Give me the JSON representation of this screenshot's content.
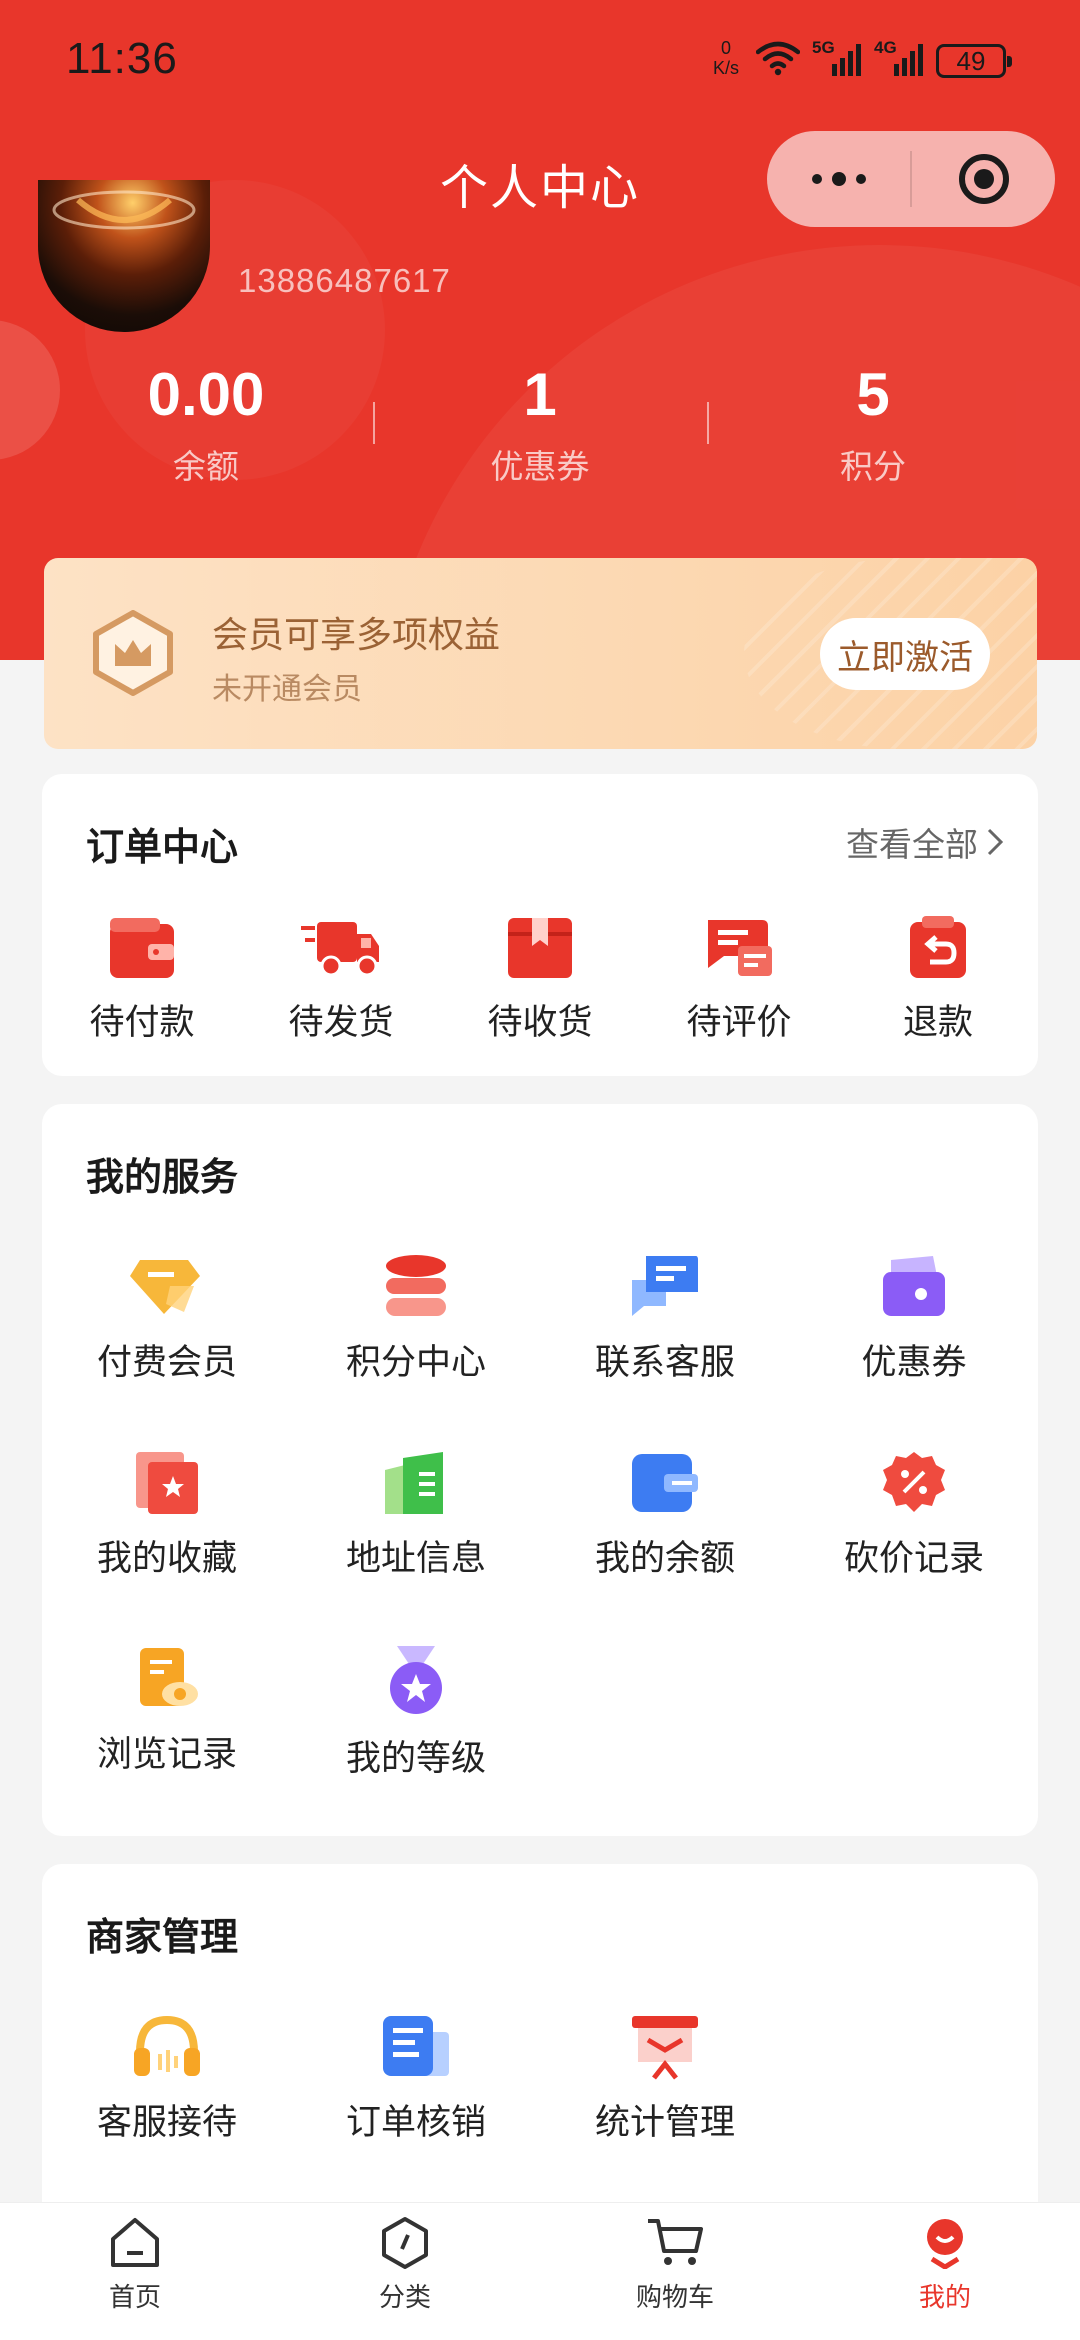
{
  "status_bar": {
    "time": "11:36",
    "net_speed_value": "0",
    "net_speed_unit": "K/s",
    "battery": "49",
    "net1": "5G",
    "net2": "4G"
  },
  "nav": {
    "title": "个人中心"
  },
  "profile": {
    "phone": "13886487617"
  },
  "stats": [
    {
      "value": "0.00",
      "label": "余额"
    },
    {
      "value": "1",
      "label": "优惠券"
    },
    {
      "value": "5",
      "label": "积分"
    }
  ],
  "member": {
    "title": "会员可享多项权益",
    "subtitle": "未开通会员",
    "button": "立即激活"
  },
  "orders": {
    "title": "订单中心",
    "view_all": "查看全部",
    "items": [
      {
        "label": "待付款",
        "icon": "wallet-icon"
      },
      {
        "label": "待发货",
        "icon": "delivery-truck-icon"
      },
      {
        "label": "待收货",
        "icon": "package-box-icon"
      },
      {
        "label": "待评价",
        "icon": "review-chat-icon"
      },
      {
        "label": "退款",
        "icon": "refund-icon"
      }
    ]
  },
  "services": {
    "title": "我的服务",
    "items": [
      {
        "label": "付费会员",
        "icon": "vip-diamond-icon"
      },
      {
        "label": "积分中心",
        "icon": "coin-stack-icon"
      },
      {
        "label": "联系客服",
        "icon": "chat-bubble-icon"
      },
      {
        "label": "优惠券",
        "icon": "coupon-wallet-icon"
      },
      {
        "label": "我的收藏",
        "icon": "favorite-star-icon"
      },
      {
        "label": "地址信息",
        "icon": "address-book-icon"
      },
      {
        "label": "我的余额",
        "icon": "balance-card-icon"
      },
      {
        "label": "砍价记录",
        "icon": "discount-badge-icon"
      },
      {
        "label": "浏览记录",
        "icon": "browse-history-icon"
      },
      {
        "label": "我的等级",
        "icon": "level-medal-icon"
      }
    ]
  },
  "merchant": {
    "title": "商家管理",
    "items": [
      {
        "label": "客服接待",
        "icon": "headset-icon"
      },
      {
        "label": "订单核销",
        "icon": "order-verify-icon"
      },
      {
        "label": "统计管理",
        "icon": "statistics-board-icon"
      }
    ]
  },
  "tabbar": [
    {
      "label": "首页",
      "icon": "home-icon"
    },
    {
      "label": "分类",
      "icon": "category-icon"
    },
    {
      "label": "购物车",
      "icon": "cart-icon"
    },
    {
      "label": "我的",
      "icon": "profile-icon"
    }
  ],
  "colors": {
    "brand": "#e8362b",
    "member_text": "#9b6235",
    "background": "#f4f4f4"
  }
}
